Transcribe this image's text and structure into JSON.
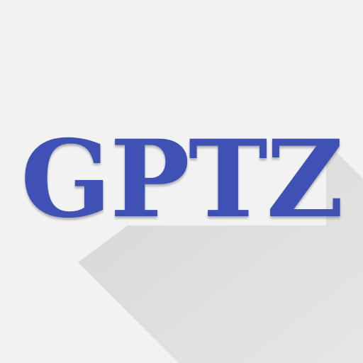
{
  "logo": {
    "text": "GPTZ",
    "color": "#3f51b5"
  },
  "background_color": "#f2f2f2",
  "shadow_color": "#d9d9d9"
}
